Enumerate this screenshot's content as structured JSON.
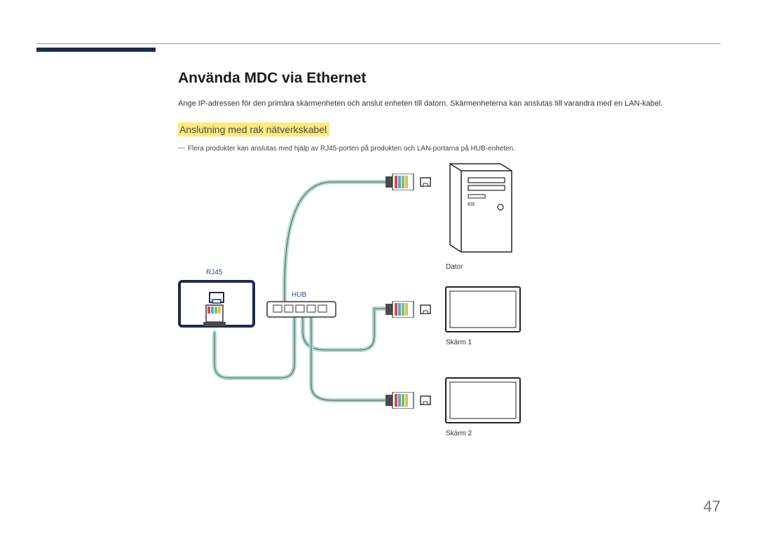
{
  "heading": "Använda MDC via Ethernet",
  "intro": "Ange IP-adressen för den primära skärmenheten och anslut enheten till datorn. Skärmenheterna kan anslutas till varandra med en LAN-kabel.",
  "subheading": "Anslutning med rak nätverkskabel",
  "note": "Flera produkter kan anslutas med hjälp av RJ45-porten på produkten och LAN-portarna på HUB-enheten.",
  "labels": {
    "rj45": "RJ45",
    "hub": "HUB",
    "dator": "Dator",
    "skarm1": "Skärm 1",
    "skarm2": "Skärm 2"
  },
  "page_number": "47"
}
